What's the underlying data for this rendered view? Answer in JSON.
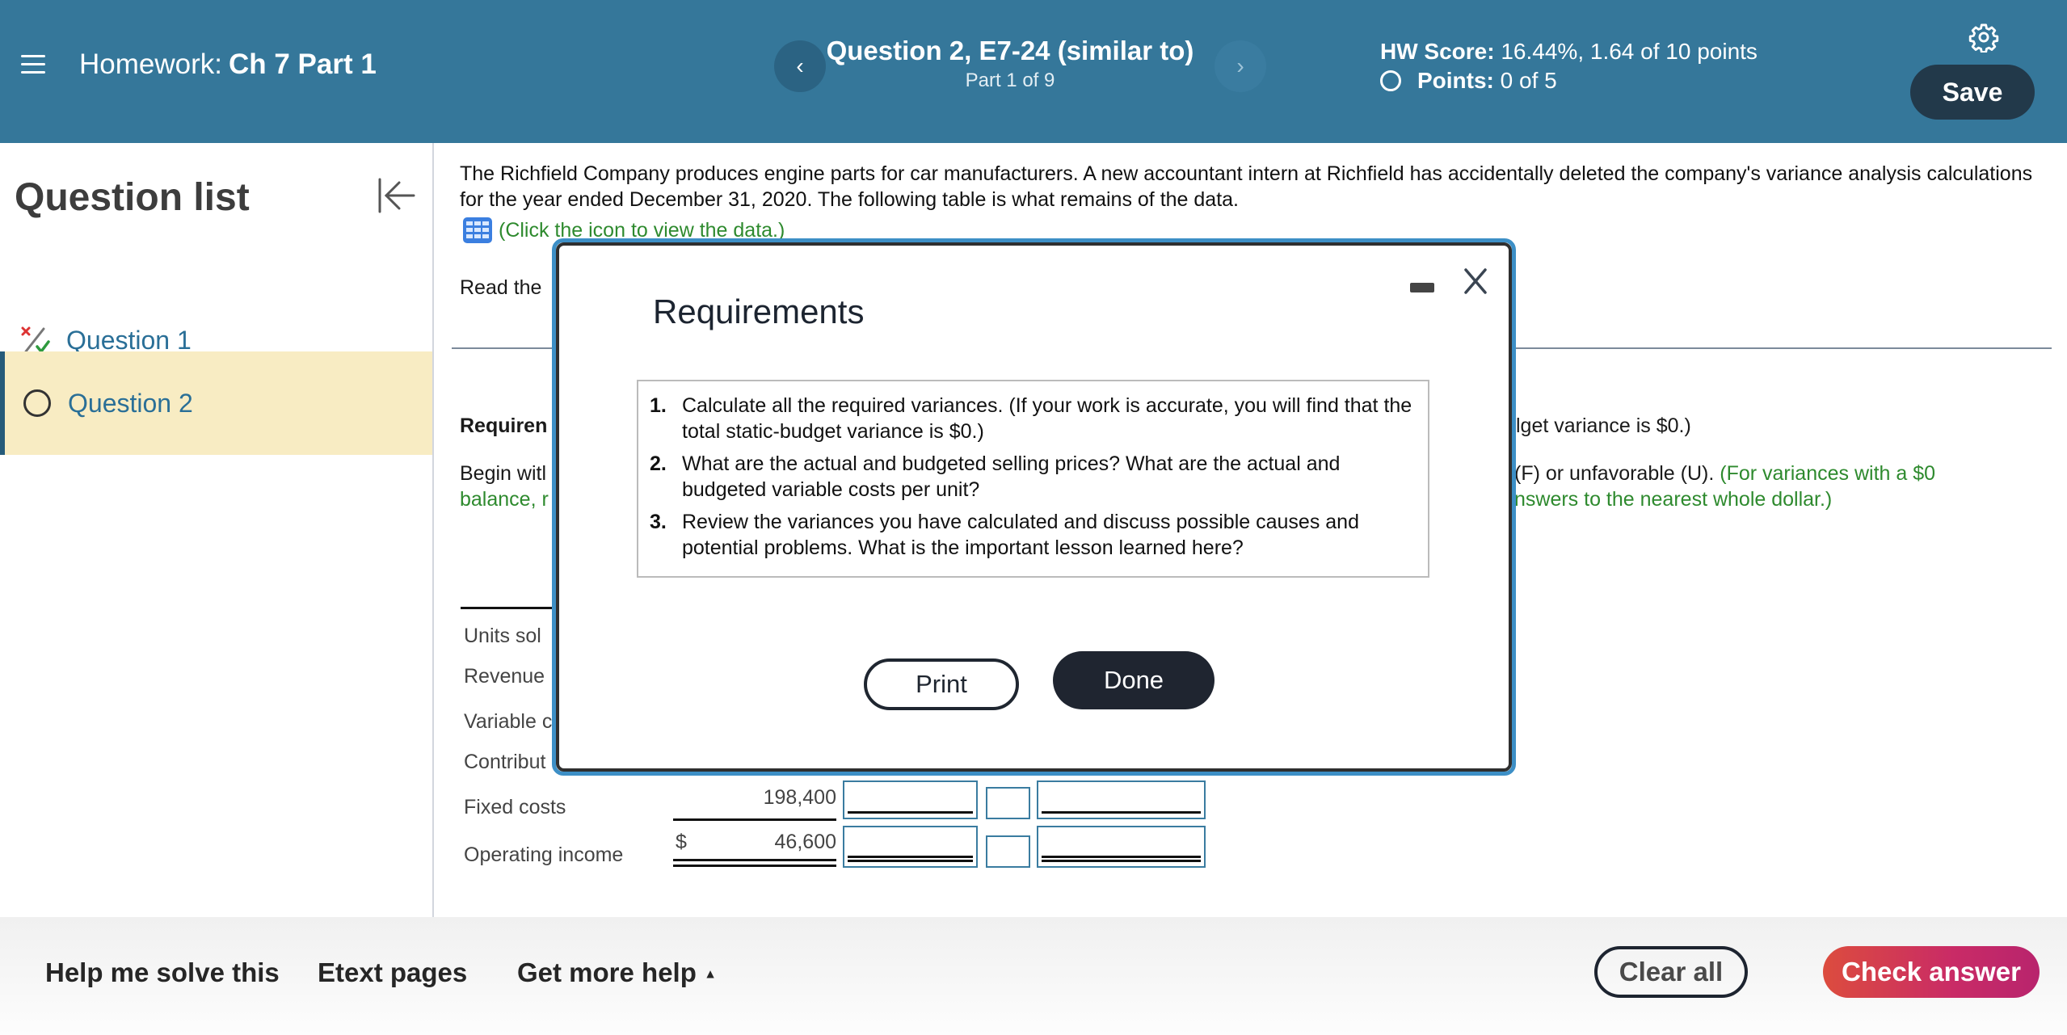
{
  "header": {
    "menu_icon": "hamburger-menu-icon",
    "homework_label": "Homework:",
    "homework_name": "Ch 7 Part 1",
    "prev_icon": "‹",
    "next_icon": "›",
    "question_title": "Question 2, E7-24 (similar to)",
    "question_part": "Part 1 of 9",
    "hw_score_label": "HW Score:",
    "hw_score_value": "16.44%, 1.64 of 10 points",
    "points_label": "Points:",
    "points_value": "0 of 5",
    "settings_icon": "gear-icon",
    "save_label": "Save"
  },
  "sidebar": {
    "title": "Question list",
    "collapse_icon": "collapse-left-icon",
    "items": [
      {
        "label": "Question 1",
        "status": "partially-correct",
        "icon": "partial-credit-icon"
      },
      {
        "label": "Question 2",
        "status": "unanswered",
        "icon": "empty-circle-icon",
        "active": true
      }
    ]
  },
  "main": {
    "intro": "The Richfield Company produces engine parts for car manufacturers. A new accountant intern at Richfield has accidentally deleted the company's variance analysis calculations for the year ended December 31, 2020. The following table is what remains of the data.",
    "data_link": "(Click the icon to view the data.)",
    "read_the": "Read the",
    "requirement_label": "Requiren",
    "requirement_right": "lget variance is $0.)",
    "begin_left_1": "Begin witl",
    "begin_left_2": "balance, r",
    "right_instr_1_black": "(F) or unfavorable (U).",
    "right_instr_1_green": "(For variances with a $0",
    "right_instr_2_green": "nswers to the nearest whole dollar.)",
    "table": {
      "rows": [
        {
          "label": "Units sold",
          "visible_label": "Units sol"
        },
        {
          "label": "Revenues",
          "visible_label": "Revenue"
        },
        {
          "label": "Variable costs",
          "visible_label": "Variable c"
        },
        {
          "label": "Contribution margin",
          "visible_label": "Contribut"
        },
        {
          "label": "Fixed costs",
          "visible_label": "Fixed costs",
          "value": "198,400"
        },
        {
          "label": "Operating income",
          "visible_label": "Operating income",
          "currency": "$",
          "value": "46,600"
        }
      ]
    }
  },
  "modal": {
    "title": "Requirements",
    "minimize_icon": "minimize-icon",
    "close_icon": "close-icon",
    "requirements": [
      {
        "num": "1.",
        "text": "Calculate all the required variances. (If your work is accurate, you will find that the total static-budget variance is $0.)"
      },
      {
        "num": "2.",
        "text": "What are the actual and budgeted selling prices? What are the actual and budgeted variable costs per unit?"
      },
      {
        "num": "3.",
        "text": "Review the variances you have calculated and discuss possible causes and potential problems. What is the important lesson learned here?"
      }
    ],
    "print_label": "Print",
    "done_label": "Done"
  },
  "footer": {
    "help_me_solve": "Help me solve this",
    "etext_pages": "Etext pages",
    "get_more_help": "Get more help",
    "get_more_help_icon": "▲",
    "clear_all": "Clear all",
    "check_answer": "Check answer"
  },
  "colors": {
    "header_bg": "#35779a",
    "save_bg": "#22394a",
    "active_question_bg": "#f8ecc3",
    "link_blue": "#2a6f97",
    "green_hint": "#2e8a2e",
    "check_answer_gradient": [
      "#dc4c3e",
      "#b8246d"
    ]
  }
}
